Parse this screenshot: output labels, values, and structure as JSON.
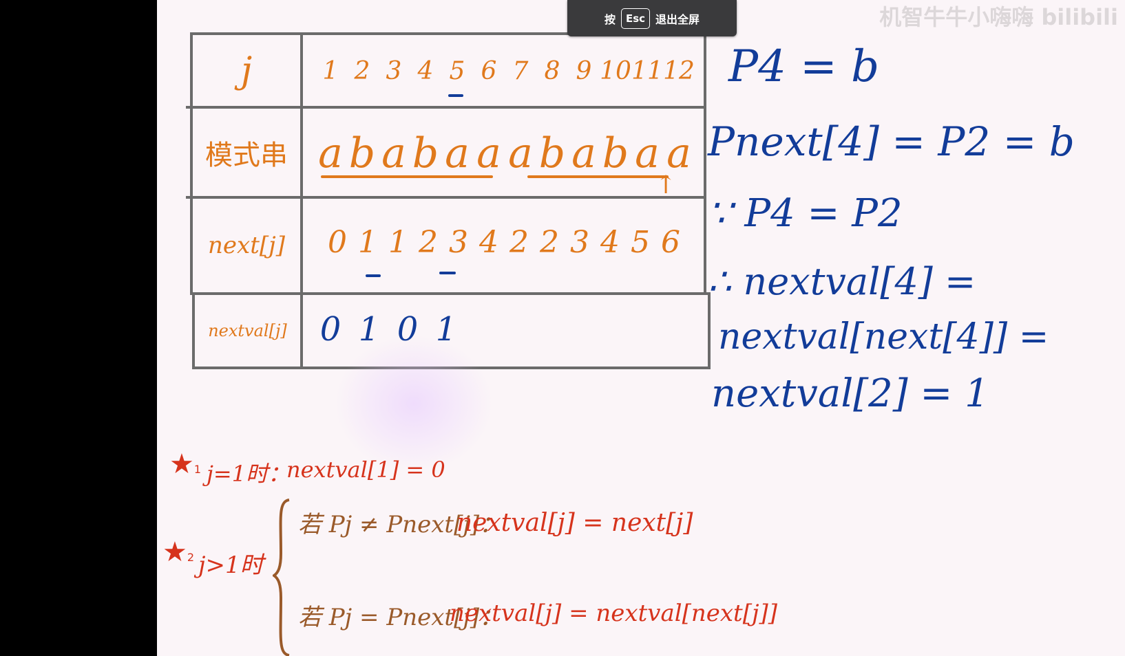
{
  "overlay": {
    "press_label": "按",
    "esc_key": "Esc",
    "exit_label": "退出全屏"
  },
  "watermark": "机智牛牛小嗨嗨 bilibili",
  "table": {
    "row_headers": [
      "j",
      "模式串",
      "next[j]",
      "nextval[j]"
    ],
    "j_values": [
      "1",
      "2",
      "3",
      "4",
      "5",
      "6",
      "7",
      "8",
      "9",
      "10",
      "11",
      "12"
    ],
    "pattern": [
      "a",
      "b",
      "a",
      "b",
      "a",
      "a",
      "a",
      "b",
      "a",
      "b",
      "a",
      "a"
    ],
    "next_values": [
      "0",
      "1",
      "1",
      "2",
      "3",
      "4",
      "2",
      "2",
      "3",
      "4",
      "5",
      "6"
    ],
    "nextval_values": [
      "0",
      "1",
      "0",
      "1"
    ]
  },
  "derivation": {
    "line1": "P4 = b",
    "line2": "Pnext[4] = P2 = b",
    "line3": "∵ P4 = P2",
    "line4": "∴ nextval[4] =",
    "line5": "nextval[next[4]] =",
    "line6": "nextval[2] = 1"
  },
  "rules": {
    "rule1_label": "j=1时：",
    "rule1_formula": "nextval[1] = 0",
    "rule2_label": "j>1时",
    "case_a_cond": "若 Pj ≠ Pnext[j]：",
    "case_a_formula": "nextval[j] = next[j]",
    "case_b_cond": "若 Pj = Pnext[j]：",
    "case_b_formula": "nextval[j] = nextval[next[j]]"
  },
  "colors": {
    "orange": "#e0791c",
    "blue": "#123c99",
    "red": "#d6331c",
    "grid": "#6b6b6b"
  }
}
